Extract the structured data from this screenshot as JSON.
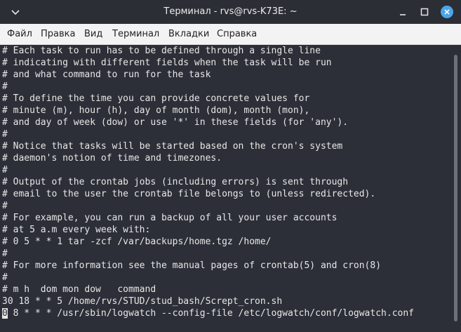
{
  "window": {
    "title": "Терминал - rvs@rvs-K73E: ~"
  },
  "menu": {
    "items": [
      "Файл",
      "Правка",
      "Вид",
      "Терминал",
      "Вкладки",
      "Справка"
    ]
  },
  "terminal": {
    "lines": [
      "# Each task to run has to be defined through a single line",
      "# indicating with different fields when the task will be run",
      "# and what command to run for the task",
      "#",
      "# To define the time you can provide concrete values for",
      "# minute (m), hour (h), day of month (dom), month (mon),",
      "# and day of week (dow) or use '*' in these fields (for 'any').",
      "#",
      "# Notice that tasks will be started based on the cron's system",
      "# daemon's notion of time and timezones.",
      "#",
      "# Output of the crontab jobs (including errors) is sent through",
      "# email to the user the crontab file belongs to (unless redirected).",
      "#",
      "# For example, you can run a backup of all your user accounts",
      "# at 5 a.m every week with:",
      "# 0 5 * * 1 tar -zcf /var/backups/home.tgz /home/",
      "#",
      "# For more information see the manual pages of crontab(5) and cron(8)",
      "#",
      "# m h  dom mon dow   command",
      "30 18 * * 5 /home/rvs/STUD/stud_bash/Scrept_cron.sh"
    ],
    "cursor_char": "0",
    "last_line_rest": " 8 * * * /usr/sbin/logwatch --config-file /etc/logwatch/conf/logwatch.conf"
  },
  "colors": {
    "terminal_bg": "#2c2f37",
    "terminal_fg": "#e7e7e7",
    "titlebar_bg": "#2b2e35",
    "menubar_bg": "#f3f3f3",
    "close_button": "#4aa6e8"
  },
  "icons": {
    "window_menu": "chevron-down-icon",
    "minimize": "minimize-icon",
    "maximize": "maximize-icon",
    "close": "close-icon"
  }
}
